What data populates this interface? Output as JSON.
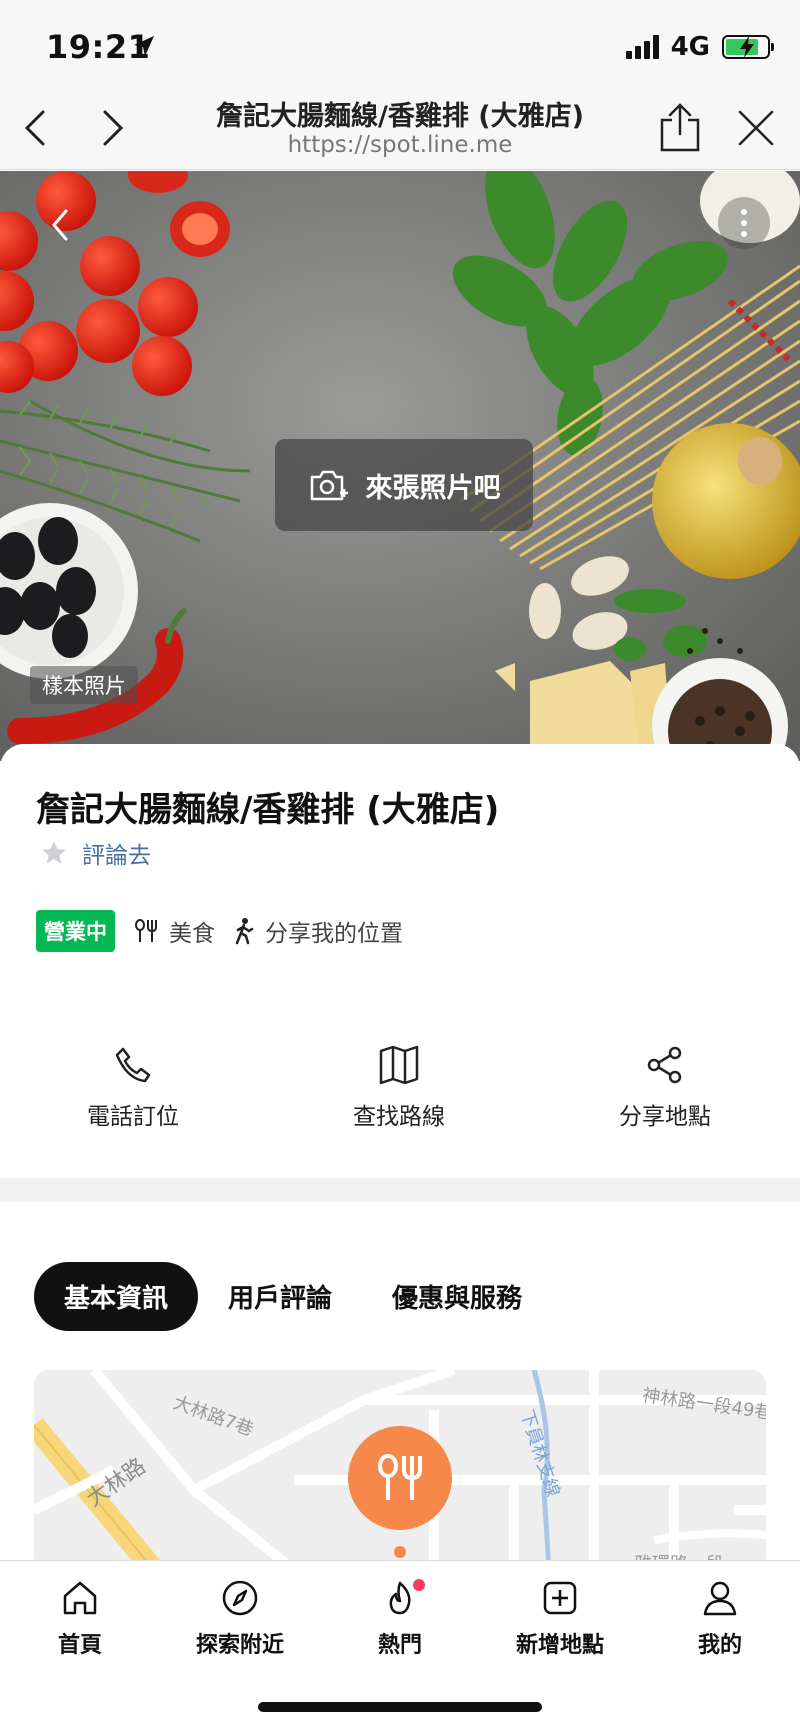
{
  "status": {
    "time": "19:21",
    "network": "4G",
    "battery_level": 0.8
  },
  "browser": {
    "title": "詹記大腸麵線/香雞排 (大雅店)",
    "url": "https://spot.line.me"
  },
  "hero": {
    "photo_button_label": "來張照片吧",
    "sample_tag": "樣本照片"
  },
  "place": {
    "title": "詹記大腸麵線/香雞排 (大雅店)",
    "review_link": "評論去",
    "open_badge": "營業中",
    "category": "美食",
    "share_location": "分享我的位置"
  },
  "actions": [
    {
      "label": "電話訂位",
      "icon": "phone-icon"
    },
    {
      "label": "查找路線",
      "icon": "map-icon"
    },
    {
      "label": "分享地點",
      "icon": "share-icon"
    }
  ],
  "tabs": [
    {
      "label": "基本資訊",
      "active": true
    },
    {
      "label": "用戶評論",
      "active": false
    },
    {
      "label": "優惠與服務",
      "active": false
    }
  ],
  "map": {
    "labels": {
      "road_1": "大林路",
      "road_2": "大林路7巷",
      "road_3": "神林路一段49巷",
      "road_4": "下員林支線",
      "road_5": "雅環路一段"
    }
  },
  "bottom_nav": [
    {
      "label": "首頁",
      "icon": "home-icon"
    },
    {
      "label": "探索附近",
      "icon": "compass-icon"
    },
    {
      "label": "熱門",
      "icon": "flame-icon",
      "badge": true
    },
    {
      "label": "新增地點",
      "icon": "add-place-icon"
    },
    {
      "label": "我的",
      "icon": "profile-icon"
    }
  ],
  "colors": {
    "open_green": "#06b755",
    "link_blue": "#4a6fa5",
    "pin_orange": "#f5884a",
    "badge_red": "#ff3b5c"
  }
}
